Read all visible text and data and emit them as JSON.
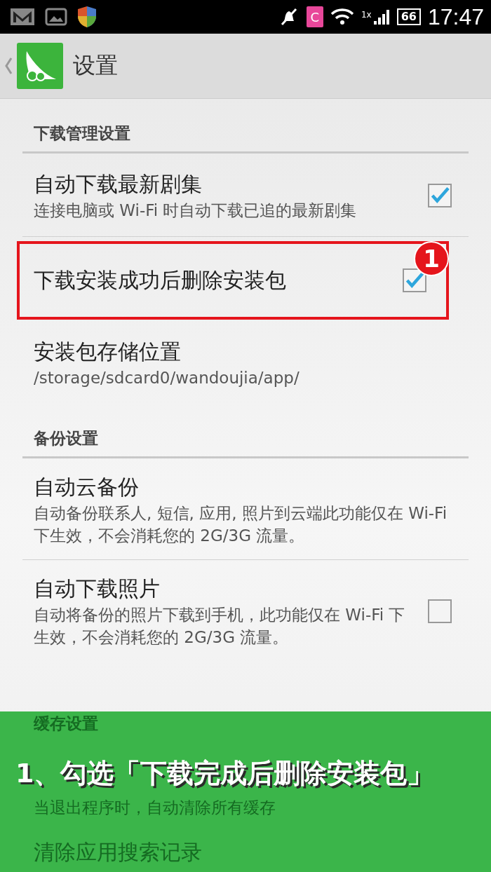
{
  "status_bar": {
    "sim_label": "C",
    "network_label": "1x",
    "battery": "66",
    "time": "17:47"
  },
  "action_bar": {
    "title": "设置"
  },
  "sections": [
    {
      "header": "下载管理设置",
      "items": [
        {
          "kind": "checkbox",
          "title": "自动下载最新剧集",
          "summary": "连接电脑或 Wi-Fi 时自动下载已追的最新剧集",
          "checked": true,
          "highlighted": false
        },
        {
          "kind": "checkbox",
          "title": "下载安装成功后删除安装包",
          "checked": true,
          "highlighted": true,
          "badge": "1"
        },
        {
          "kind": "plain",
          "title": "安装包存储位置",
          "summary": "/storage/sdcard0/wandoujia/app/",
          "highlighted": false
        }
      ]
    },
    {
      "header": "备份设置",
      "items": [
        {
          "kind": "plain",
          "title": "自动云备份",
          "summary": "自动备份联系人, 短信, 应用, 照片到云端此功能仅在 Wi-Fi 下生效，不会消耗您的 2G/3G 流量。",
          "highlighted": false
        },
        {
          "kind": "checkbox",
          "title": "自动下载照片",
          "summary": "自动将备份的照片下载到手机，此功能仅在 Wi-Fi 下生效，不会消耗您的 2G/3G 流量。",
          "checked": false,
          "highlighted": false
        }
      ]
    }
  ],
  "overlay": {
    "covered_header": "缓存设置",
    "caption": "1、勾选「下载完成后删除安装包」",
    "covered_summary": "当退出程序时，自动清除所有缓存",
    "covered_item": "清除应用搜索记录"
  }
}
